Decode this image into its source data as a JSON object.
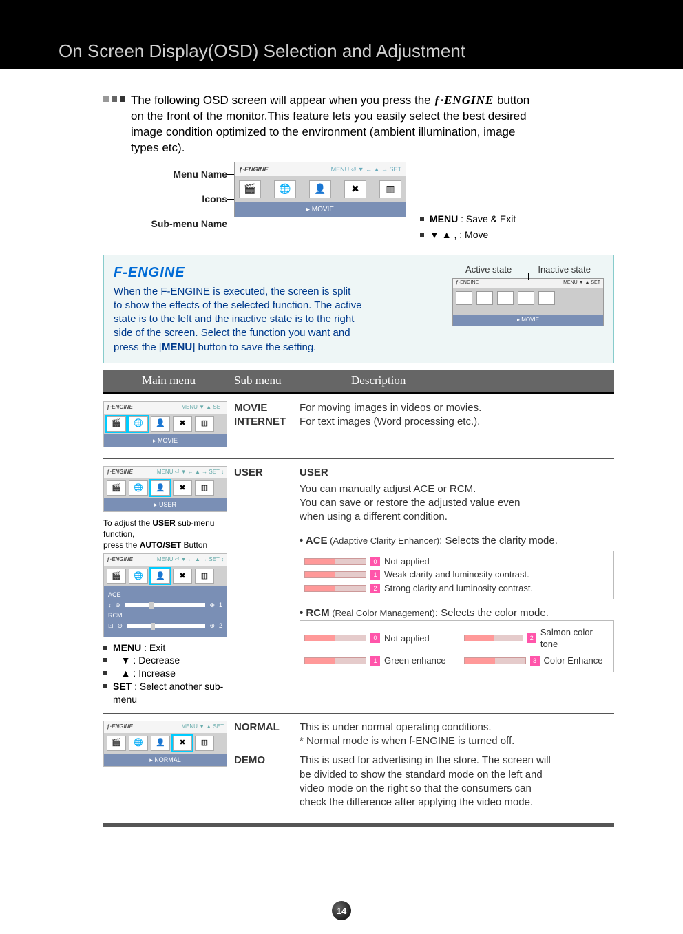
{
  "header": {
    "title": "On Screen Display(OSD) Selection and Adjustment"
  },
  "intro": {
    "line1": "The following OSD screen will appear when you press the ",
    "logo": "ƒ·ENGINE",
    "line1b": " button",
    "line2": "on the front of the monitor.This feature lets you easily select the best desired",
    "line3": "image condition optimized to the environment (ambient illumination, image",
    "line4": "types etc)."
  },
  "diagram": {
    "label_menu": "Menu Name",
    "label_icons": "Icons",
    "label_submenu": "Sub-menu Name",
    "osd_title": "ƒ·ENGINE",
    "osd_header_right": "MENU ⏎   ▼ ←   ▲ →   SET",
    "osd_footer": "▸  MOVIE",
    "hint_menu": "MENU",
    "hint_menu_text": " : Save & Exit",
    "hint_move": " ,      : Move"
  },
  "fengine_panel": {
    "title": "F-ENGINE",
    "body1": "When the F-ENGINE is executed, the screen is split",
    "body2": "to show the effects of the selected function. The active",
    "body3": "state is to the left and the inactive state is to the right",
    "body4": "side of the screen. Select the function you want and",
    "body5": "press the [",
    "body5b": "MENU",
    "body5c": "] button to save the setting.",
    "state_active": "Active state",
    "state_inactive": "Inactive state",
    "mini_footer": "▸  MOVIE"
  },
  "table_header": {
    "c1": "Main menu",
    "c2": "Sub menu",
    "c3": "Description"
  },
  "row1": {
    "sub_movie": "MOVIE",
    "desc_movie": "For moving images in videos or movies.",
    "sub_internet": "INTERNET",
    "desc_internet": "For text images (Word processing etc.).",
    "osd_footer": "▸  MOVIE"
  },
  "row2": {
    "sub_user": "USER",
    "user_title": "USER",
    "user_l1": "You can manually adjust ACE or RCM.",
    "user_l2": "You can save or restore the adjusted value even",
    "user_l3": "when using a different condition.",
    "ace_label": "• ACE",
    "ace_sub": " (Adaptive Clarity Enhancer)",
    "ace_desc": ": Selects the clarity mode.",
    "ace_0": "Not applied",
    "ace_1": "Weak clarity and luminosity contrast.",
    "ace_2": "Strong clarity and luminosity contrast.",
    "rcm_label": "• RCM",
    "rcm_sub": " (Real Color Management)",
    "rcm_desc": ": Selects the color mode.",
    "rcm_0": "Not applied",
    "rcm_1": "Green enhance",
    "rcm_2": "Salmon color tone",
    "rcm_3": "Color Enhance",
    "adjust_note1": "To adjust the ",
    "adjust_note_user": "USER",
    "adjust_note2": " sub-menu function,",
    "adjust_note3": "press the ",
    "adjust_note_autoset": "AUTO/SET",
    "adjust_note4": " Button",
    "osd_user_footer": "▸ USER",
    "osd_ace_label": "ACE",
    "osd_rcm_label": "RCM",
    "osd_header_set": "MENU ⏎   ▼ ←   ▲ →   SET ↕",
    "ctrl_menu": "MENU",
    "ctrl_menu_t": " : Exit",
    "ctrl_down_t": "    : Decrease",
    "ctrl_up_t": "    : Increase",
    "ctrl_set": "SET",
    "ctrl_set_t": "    : Select another sub-menu"
  },
  "row3": {
    "sub_normal": "NORMAL",
    "desc_normal1": "This is under normal operating conditions.",
    "desc_normal2": "* Normal mode is when f-ENGINE is turned off.",
    "sub_demo": "DEMO",
    "desc_demo1": "This is used for advertising in the store. The screen will",
    "desc_demo2": "be divided to show the standard mode on the left and",
    "desc_demo3": "video mode on the right so that the consumers can",
    "desc_demo4": "check the difference after applying the video mode.",
    "osd_footer": "▸  NORMAL"
  },
  "page_number": "14"
}
